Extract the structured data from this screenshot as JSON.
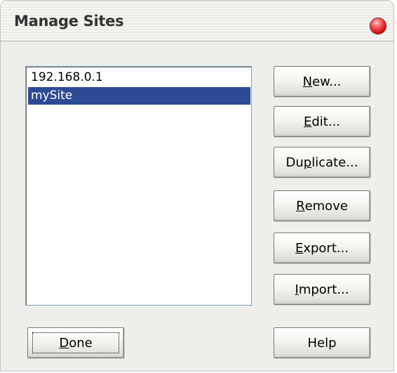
{
  "dialog": {
    "title": "Manage Sites"
  },
  "sites": [
    {
      "label": "192.168.0.1",
      "selected": false
    },
    {
      "label": "mySite",
      "selected": true
    }
  ],
  "buttons": {
    "new": {
      "mnemonic": "N",
      "rest": "ew..."
    },
    "edit": {
      "mnemonic": "E",
      "rest": "dit..."
    },
    "duplicate": {
      "pre": "Du",
      "mnemonic": "p",
      "rest": "licate..."
    },
    "remove": {
      "mnemonic": "R",
      "rest": "emove"
    },
    "export": {
      "mnemonic": "E",
      "rest": "xport..."
    },
    "import": {
      "mnemonic": "I",
      "rest": "mport..."
    },
    "done": {
      "mnemonic": "D",
      "rest": "one"
    },
    "help": {
      "label": "Help"
    }
  },
  "colors": {
    "selection": "#2d4a94",
    "close_button": "#d21010",
    "dialog_background": "#eeeeea"
  }
}
